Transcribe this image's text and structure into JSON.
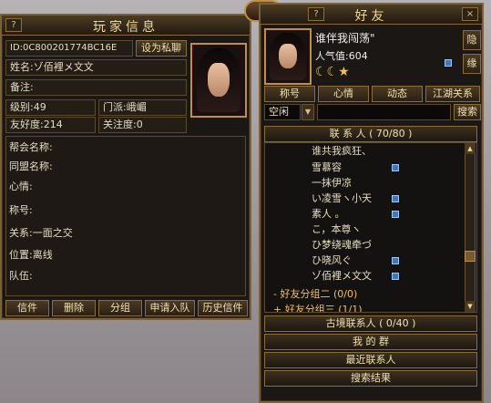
{
  "player_info": {
    "title": "玩家信息",
    "close": "?",
    "id_field": "ID:0C800201774BC16E",
    "set_private_button": "设为私聊",
    "name_field": "姓名:ゾ佰裡メ文文",
    "note_field": "备注:",
    "level": "级别:49",
    "sect": "门派:峨嵋",
    "friendship": "友好度:214",
    "attention": "关注度:0",
    "guild_name": "帮会名称:",
    "alliance_name": "同盟名称:",
    "mood": "心情:",
    "nickname": "称号:",
    "relation": "关系:一面之交",
    "location": "位置:离线",
    "team": "队伍:",
    "buttons": [
      "信件",
      "删除",
      "分组",
      "申请入队",
      "历史信件"
    ]
  },
  "friends": {
    "title": "好友",
    "close": "?",
    "player_name": "谁伴我闯荡\"",
    "popularity": "人气值:604",
    "side_buttons": [
      "隐",
      "缘"
    ],
    "tabs": [
      "称号",
      "心情",
      "动态",
      "江湖关系"
    ],
    "status_select": "空闲",
    "search_button": "搜索",
    "contacts_header": "联 系 人 ( 70/80 )",
    "contacts": [
      {
        "name": "谁共我疯狂、",
        "online": false
      },
      {
        "name": "雪慕容",
        "online": true
      },
      {
        "name": "一抹伊凉",
        "online": false
      },
      {
        "name": "い凌雪ヽ小天",
        "online": true
      },
      {
        "name": "素人 。",
        "online": true
      },
      {
        "name": "こ，本尊ヽ",
        "online": false
      },
      {
        "name": "ひ梦绕魂牵づ",
        "online": false
      },
      {
        "name": "ひ晓风ぐ",
        "online": true
      },
      {
        "name": "ゾ佰裡メ文文",
        "online": true
      }
    ],
    "groups": [
      {
        "label": "- 好友分组二 (0/0)"
      },
      {
        "label": "+ 好友分组三 (1/1)"
      }
    ],
    "sections": [
      "古境联系人 ( 0/40 )",
      "我 的 群",
      "最近联系人",
      "搜索结果"
    ]
  },
  "colors": {
    "online": "#3a78c0",
    "gold": "#f0d890",
    "panel": "#1a1714"
  }
}
